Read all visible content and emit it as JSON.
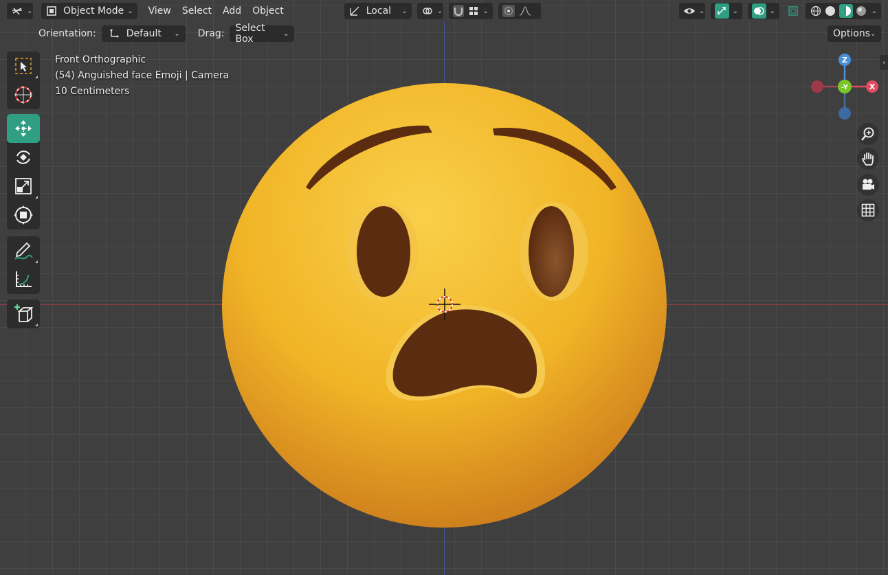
{
  "header": {
    "mode": "Object Mode",
    "menus": [
      "View",
      "Select",
      "Add",
      "Object"
    ],
    "transform_orientation": "Local",
    "options_label": "Options"
  },
  "tool_settings": {
    "orientation_label": "Orientation:",
    "orientation_value": "Default",
    "drag_label": "Drag:",
    "drag_value": "Select Box"
  },
  "overlay": {
    "view_name": "Front Orthographic",
    "object_info": "(54) Anguished face Emoji | Camera",
    "scale": "10 Centimeters"
  },
  "gizmo": {
    "z_label": "Z",
    "y_label": "-Y",
    "x_label": "X"
  },
  "toolbar": {
    "active_tool": "move",
    "tools": [
      "select-box",
      "cursor",
      "move",
      "rotate",
      "scale",
      "transform",
      "annotate",
      "measure",
      "add-cube"
    ]
  },
  "colors": {
    "viewport_bg": "#3f3f3f",
    "accent": "#2f9e83",
    "x_axis": "#e04b5f",
    "y_axis": "#79c628",
    "z_axis": "#4b8fd9",
    "emoji_yellow": "#f2b82a",
    "emoji_brown": "#5b2c0f"
  }
}
